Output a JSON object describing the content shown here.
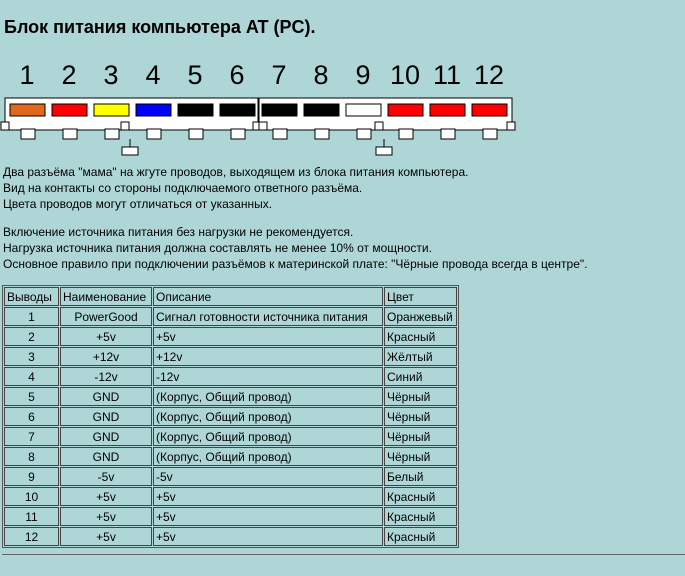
{
  "title": "Блок питания компьютера AT (PC).",
  "connector": {
    "pins": [
      {
        "num": "1",
        "color": "#e0691e"
      },
      {
        "num": "2",
        "color": "#ff0000"
      },
      {
        "num": "3",
        "color": "#ffff00"
      },
      {
        "num": "4",
        "color": "#0000ff"
      },
      {
        "num": "5",
        "color": "#000000"
      },
      {
        "num": "6",
        "color": "#000000"
      },
      {
        "num": "7",
        "color": "#000000"
      },
      {
        "num": "8",
        "color": "#000000"
      },
      {
        "num": "9",
        "color": "#ffffff"
      },
      {
        "num": "10",
        "color": "#ff0000"
      },
      {
        "num": "11",
        "color": "#ff0000"
      },
      {
        "num": "12",
        "color": "#ff0000"
      }
    ]
  },
  "description": {
    "line1": "Два разъёма \"мама\" на жгуте проводов, выходящем из блока питания компьютера.",
    "line2": "Вид на контакты со стороны подключаемого ответного разъёма.",
    "line3": "Цвета проводов могут отличаться от указанных.",
    "line4": "Включение источника питания без нагрузки не рекомендуется.",
    "line5": "Нагрузка источника питания должна составлять не менее 10% от мощности.",
    "line6": "Основное правило при подключении разъёмов к материнской плате: \"Чёрные провода всегда в центре\"."
  },
  "table": {
    "headers": {
      "num": "Выводы",
      "name": "Наименование",
      "desc": "Описание",
      "color": "Цвет"
    },
    "rows": [
      {
        "num": "1",
        "name": "PowerGood",
        "desc": "Сигнал готовности источника питания",
        "color": "Оранжевый"
      },
      {
        "num": "2",
        "name": "+5v",
        "desc": "+5v",
        "color": "Красный"
      },
      {
        "num": "3",
        "name": "+12v",
        "desc": "+12v",
        "color": "Жёлтый"
      },
      {
        "num": "4",
        "name": "-12v",
        "desc": "-12v",
        "color": "Синий"
      },
      {
        "num": "5",
        "name": "GND",
        "desc": "(Корпус, Общий провод)",
        "color": "Чёрный"
      },
      {
        "num": "6",
        "name": "GND",
        "desc": "(Корпус, Общий провод)",
        "color": "Чёрный"
      },
      {
        "num": "7",
        "name": "GND",
        "desc": "(Корпус, Общий провод)",
        "color": "Чёрный"
      },
      {
        "num": "8",
        "name": "GND",
        "desc": "(Корпус, Общий провод)",
        "color": "Чёрный"
      },
      {
        "num": "9",
        "name": "-5v",
        "desc": "-5v",
        "color": "Белый"
      },
      {
        "num": "10",
        "name": "+5v",
        "desc": "+5v",
        "color": "Красный"
      },
      {
        "num": "11",
        "name": "+5v",
        "desc": "+5v",
        "color": "Красный"
      },
      {
        "num": "12",
        "name": "+5v",
        "desc": "+5v",
        "color": "Красный"
      }
    ]
  }
}
